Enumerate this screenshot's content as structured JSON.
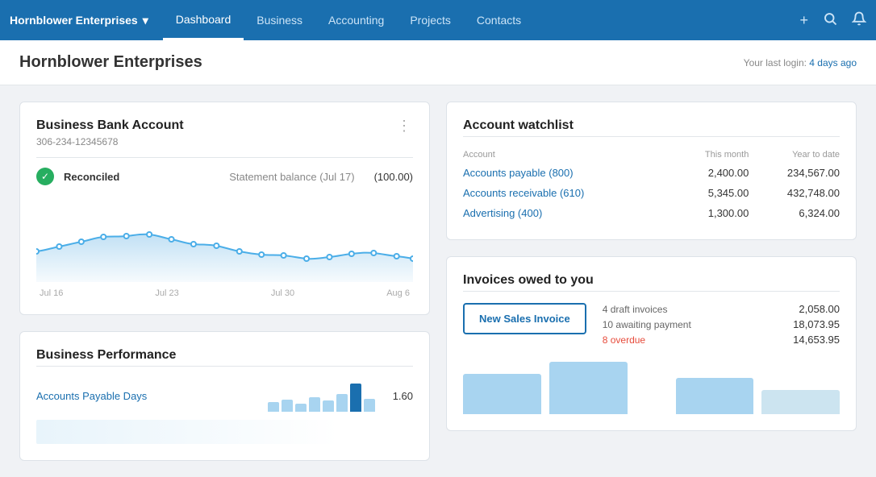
{
  "nav": {
    "brand": "Hornblower Enterprises",
    "chevron": "▾",
    "links": [
      {
        "label": "Dashboard",
        "active": true
      },
      {
        "label": "Business",
        "active": false
      },
      {
        "label": "Accounting",
        "active": false
      },
      {
        "label": "Projects",
        "active": false
      },
      {
        "label": "Contacts",
        "active": false
      }
    ],
    "add_icon": "+",
    "search_icon": "🔍",
    "bell_icon": "🔔"
  },
  "header": {
    "title": "Hornblower Enterprises",
    "last_login_prefix": "Your last login: ",
    "last_login_value": "4 days ago"
  },
  "bank_card": {
    "title": "Business Bank Account",
    "account_number": "306-234-12345678",
    "menu_icon": "⋮",
    "reconcile_label": "Reconciled",
    "statement_label": "Statement balance (Jul 17)",
    "balance_amount": "(100.00)",
    "chart_labels": [
      "Jul 16",
      "Jul 23",
      "Jul 30",
      "Aug 6"
    ]
  },
  "watchlist": {
    "title": "Account watchlist",
    "columns": [
      "Account",
      "This month",
      "Year to date"
    ],
    "rows": [
      {
        "account": "Accounts payable (800)",
        "this_month": "2,400.00",
        "year_to_date": "234,567.00"
      },
      {
        "account": "Accounts receivable (610)",
        "this_month": "5,345.00",
        "year_to_date": "432,748.00"
      },
      {
        "account": "Advertising (400)",
        "this_month": "1,300.00",
        "year_to_date": "6,324.00"
      }
    ]
  },
  "invoices": {
    "title": "Invoices owed to you",
    "new_invoice_label": "New Sales Invoice",
    "stats": [
      {
        "label": "4 draft invoices",
        "value": "2,058.00",
        "overdue": false
      },
      {
        "label": "10 awaiting payment",
        "value": "18,073.95",
        "overdue": false
      },
      {
        "label": "8 overdue",
        "value": "14,653.95",
        "overdue": true
      }
    ]
  },
  "performance": {
    "title": "Business Performance",
    "rows": [
      {
        "label": "Accounts Payable Days",
        "value": "1.60"
      }
    ]
  }
}
